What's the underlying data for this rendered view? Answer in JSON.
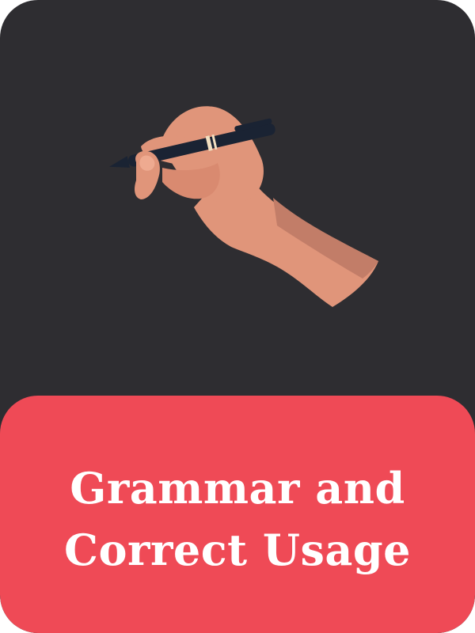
{
  "card": {
    "title_line1": "Grammar and",
    "title_line2": "Correct Usage",
    "illustration_icon": "hand-writing-with-pen-icon"
  },
  "colors": {
    "background": "#2e2d31",
    "banner": "#ef4a56",
    "title_text": "#ffffff",
    "skin": "#e0957a",
    "skin_shadow": "#c27d68",
    "pen": "#1a2333",
    "pen_band": "#f2dfc0"
  }
}
